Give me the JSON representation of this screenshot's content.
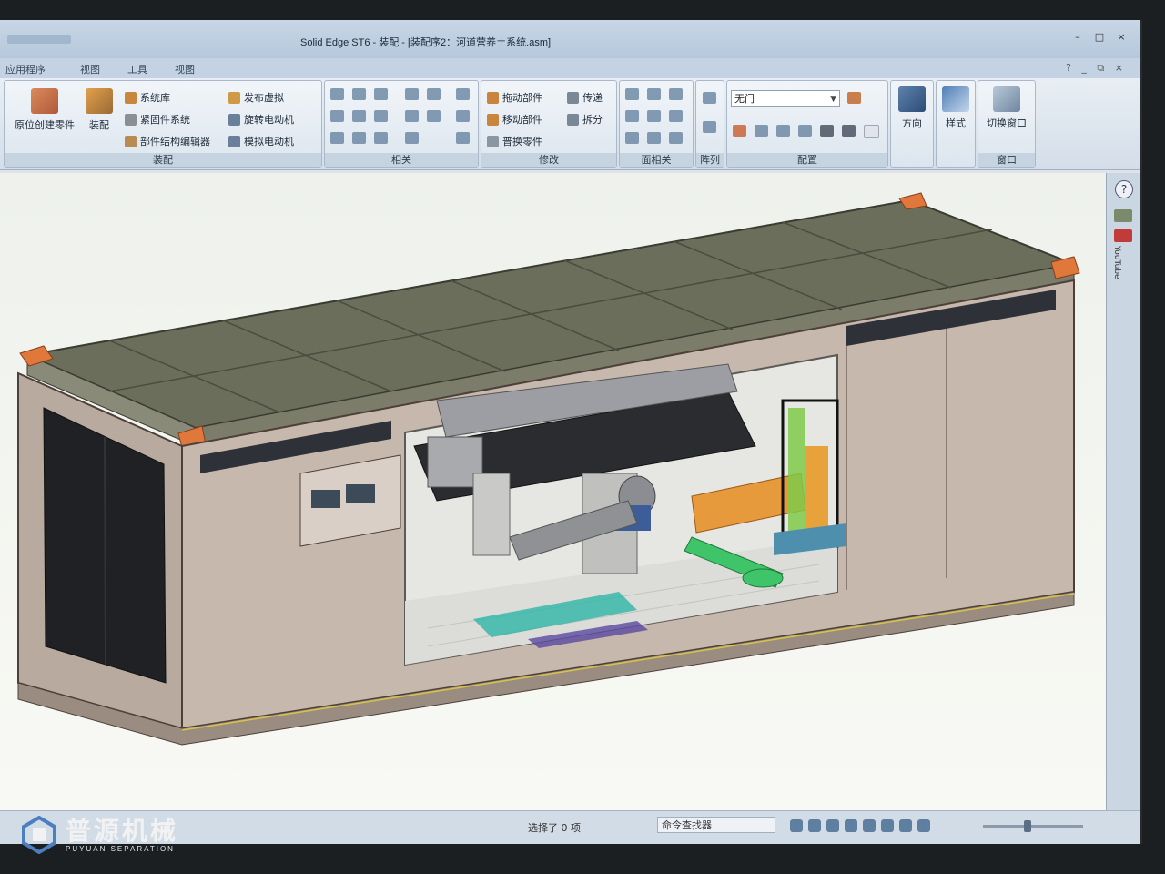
{
  "window": {
    "title": "Solid Edge ST6 - 装配 - [装配序2：河道营养土系统.asm]",
    "controls": [
      "–",
      "□",
      "×"
    ]
  },
  "menu": {
    "items": [
      "应用程序",
      "视图",
      "工具",
      "视图"
    ],
    "right": "? _ ⧉ ×"
  },
  "ribbon": {
    "assembly": {
      "label": "装配",
      "create_in_place": "原位创建零件",
      "assemble": "装配",
      "system_library": "系统库",
      "fastener_system": "紧固件系统",
      "structure_editor": "部件结构编辑器",
      "publish_virtual": "发布虚拟",
      "rotary_motor": "旋转电动机",
      "simulate_motor": "模拟电动机"
    },
    "relations": {
      "label": "相关"
    },
    "modify": {
      "label": "修改",
      "drag_component": "拖动部件",
      "move_component": "移动部件",
      "replace_part": "普换零件",
      "transfer": "传递",
      "disperse": "拆分"
    },
    "face_relations": {
      "label": "面相关"
    },
    "pattern": {
      "label": "阵列"
    },
    "configuration": {
      "label": "配置",
      "combo_value": "无门"
    },
    "orient": {
      "label": "方向"
    },
    "style": {
      "label": "样式"
    },
    "window_group": {
      "label": "窗口",
      "switch_window": "切换窗口"
    }
  },
  "sidebar": {
    "help": "?",
    "youtube": "YouTube"
  },
  "status": {
    "selected": "选择了 0 项",
    "command_finder": "命令查找器"
  },
  "watermark": {
    "brand_cn": "普源机械",
    "brand_en": "PUYUAN SEPARATION"
  },
  "colors": {
    "container_frame": "#b8a89a",
    "accent_orange": "#e0783c",
    "pipe_green": "#3fc46a",
    "motor_orange": "#e79a3c",
    "roof_dark": "#656857",
    "frame_blue": "#4f8fae"
  }
}
